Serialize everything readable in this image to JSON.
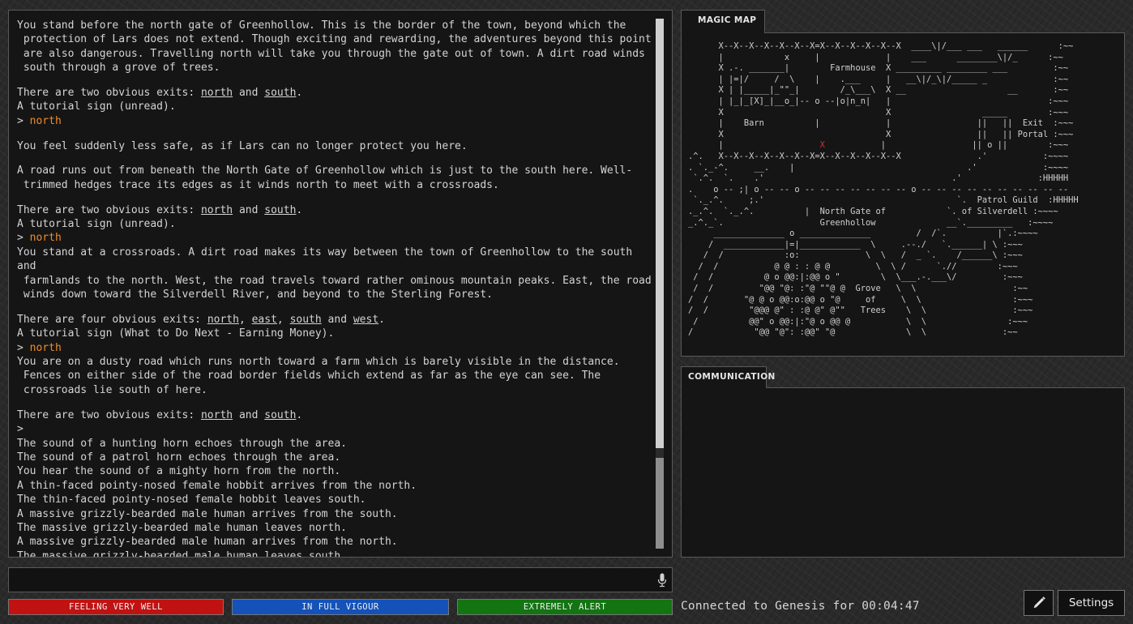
{
  "output": {
    "blocks": [
      {
        "type": "text",
        "text": "You stand before the north gate of Greenhollow. This is the border of the town, beyond which the\n protection of Lars does not extend. Though exciting and rewarding, the adventures beyond this point\n are also dangerous. Travelling north will take you through the gate out of town. A dirt road winds\n south through a grove of trees."
      },
      {
        "type": "gap"
      },
      {
        "type": "exits",
        "prefix": "There are two obvious exits: ",
        "exits": [
          "north",
          "south"
        ],
        "joiners": [
          " and "
        ],
        "suffix": "."
      },
      {
        "type": "text",
        "text": "A tutorial sign (unread)."
      },
      {
        "type": "cmd",
        "prompt": "> ",
        "text": "north"
      },
      {
        "type": "gap"
      },
      {
        "type": "text",
        "text": "You feel suddenly less safe, as if Lars can no longer protect you here."
      },
      {
        "type": "gap"
      },
      {
        "type": "text",
        "text": "A road runs out from beneath the North Gate of Greenhollow which is just to the south here. Well-\n trimmed hedges trace its edges as it winds north to meet with a crossroads."
      },
      {
        "type": "gap"
      },
      {
        "type": "exits",
        "prefix": "There are two obvious exits: ",
        "exits": [
          "north",
          "south"
        ],
        "joiners": [
          " and "
        ],
        "suffix": "."
      },
      {
        "type": "text",
        "text": "A tutorial sign (unread)."
      },
      {
        "type": "cmd",
        "prompt": "> ",
        "text": "north"
      },
      {
        "type": "text",
        "text": "You stand at a crossroads. A dirt road makes its way between the town of Greenhollow to the south and\n farmlands to the north. West, the road travels toward rather ominous mountain peaks. East, the road\n winds down toward the Silverdell River, and beyond to the Sterling Forest."
      },
      {
        "type": "gap"
      },
      {
        "type": "exits",
        "prefix": "There are four obvious exits: ",
        "exits": [
          "north",
          "east",
          "south",
          "west"
        ],
        "joiners": [
          ", ",
          ", ",
          " and "
        ],
        "suffix": "."
      },
      {
        "type": "text",
        "text": "A tutorial sign (What to Do Next - Earning Money)."
      },
      {
        "type": "cmd",
        "prompt": "> ",
        "text": "north"
      },
      {
        "type": "text",
        "text": "You are on a dusty road which runs north toward a farm which is barely visible in the distance.\n Fences on either side of the road border fields which extend as far as the eye can see. The\n crossroads lie south of here."
      },
      {
        "type": "gap"
      },
      {
        "type": "exits",
        "prefix": "There are two obvious exits: ",
        "exits": [
          "north",
          "south"
        ],
        "joiners": [
          " and "
        ],
        "suffix": "."
      },
      {
        "type": "text",
        "text": ">"
      },
      {
        "type": "text",
        "text": "The sound of a hunting horn echoes through the area."
      },
      {
        "type": "text",
        "text": "The sound of a patrol horn echoes through the area."
      },
      {
        "type": "text",
        "text": "You hear the sound of a mighty horn from the north."
      },
      {
        "type": "text",
        "text": "A thin-faced pointy-nosed female hobbit arrives from the north."
      },
      {
        "type": "text",
        "text": "The thin-faced pointy-nosed female hobbit leaves south."
      },
      {
        "type": "text",
        "text": "A massive grizzly-bearded male human arrives from the south."
      },
      {
        "type": "text",
        "text": "The massive grizzly-bearded male human leaves north."
      },
      {
        "type": "text",
        "text": "A massive grizzly-bearded male human arrives from the north."
      },
      {
        "type": "text",
        "text": "The massive grizzly-bearded male human leaves south."
      }
    ]
  },
  "input": {
    "value": "",
    "placeholder": ""
  },
  "status": {
    "health": "FEELING VERY WELL",
    "vigour": "IN FULL VIGOUR",
    "alertness": "EXTREMELY ALERT"
  },
  "connection": "Connected to Genesis for 00:04:47",
  "buttons": {
    "edit_icon": "pencil-icon",
    "settings": "Settings"
  },
  "map": {
    "title": "MAGIC MAP",
    "player_marker": "X",
    "lines_before": [
      "      X--X--X--X--X--X--X=X--X--X--X--X--X  ____\\|/___ ___   ______      :~~",
      "      |            x     |             |    ___      ________\\|/_      :~~",
      "      X .-. _______|        Farmhouse  X _________ ________ ___         :~~",
      "      | |=|/     /  \\    |    .___     |   __\\|/_\\|/_____ _             :~~",
      "      X | |_____|_\"\"_|        /_\\___\\  X __                    __       :~~",
      "      | |_|_[X]_|__o_|-- o --|o|n_n|   |                               :~~~",
      "      X                                X                  _____        :~~~",
      "      |    Barn          |             |                 ||   ||  Exit  :~~~",
      "      X                                X                 ||   || Portal :~~~"
    ],
    "marker_prefix": "      |                   ",
    "marker_suffix": "           |                 || o ||        :~~~",
    "lines_after": [
      ".^.   X--X--X--X--X--X--X=X--X--X--X--X--X               .'           :~~~~",
      ". `._-^.     __.    |                                  .'             :~~~~",
      " `.^.  `.    .'                                     .'               :HHHHH",
      ".    o -- ;| o -- -- o -- -- -- -- -- -- -- o -- -- -- -- -- -- -- -- -- --",
      " `._.^.     ;.'                                      `.  Patrol Guild  :HHHHH",
      "._.^.  `._.^.          |  North Gate of            `. of Silverdell :~~~~",
      "_.^._`.                   Greenhollow              __`._________   :~~~~",
      "     ______________ o ______________         /  /`.          |`.:~~~~",
      "    /  ____________|=|____________  \\     .--./   `.______| \\ :~~~",
      "   /  /            :o:             \\  \\   /  _ `.    /______\\ :~~~",
      "  /  /           @ @ : : @ @         \\  \\ /      `.//        :~~~",
      " /  /          @ o @@:|:@@ o \"        \\  \\___.-.___\\/         :~~~",
      " /  /         \"@@ \"@: :\"@ \"\"@ @  Grove   \\  \\                   :~~",
      "/  /       \"@ @ o @@:o:@@ o \"@     of     \\  \\                  :~~~",
      "/  /        \"@@@ @\" : :@ @\" @\"\"   Trees    \\  \\                 :~~~",
      " /          @@\" o @@:|:\"@ o @@ @           \\  \\                :~~~",
      "/            \"@@ \"@\": :@@\" \"@              \\  \\               :~~"
    ]
  },
  "communication": {
    "title": "COMMUNICATION"
  }
}
